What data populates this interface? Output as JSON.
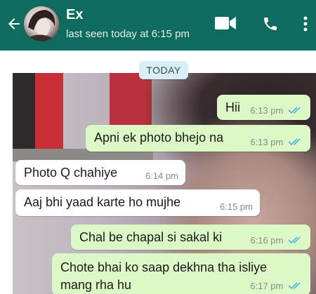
{
  "header": {
    "contact_name": "Ex",
    "status": "last seen today at 6:15 pm"
  },
  "date_chip": "TODAY",
  "messages": [
    {
      "direction": "out",
      "text": "Hii",
      "time": "6:13 pm",
      "read": true
    },
    {
      "direction": "out",
      "text": "Apni ek photo bhejo na",
      "time": "6:13 pm",
      "read": true
    },
    {
      "direction": "in",
      "text": "Photo Q chahiye",
      "time": "6:14 pm"
    },
    {
      "direction": "in",
      "text": "Aaj bhi yaad karte ho mujhe",
      "time": "6:15 pm"
    },
    {
      "direction": "out",
      "text": "Chal be chapal si sakal ki",
      "time": "6:16 pm",
      "read": true
    },
    {
      "direction": "out",
      "text": "Chote bhai ko saap dekhna tha isliye mang rha hu",
      "time": "6:17 pm",
      "read": true
    }
  ],
  "colors": {
    "header": "#0e6b5e",
    "outgoing_bubble": "#dcf8c6",
    "incoming_bubble": "#ffffff",
    "read_tick": "#4fb3e6",
    "date_chip": "#d8eef5"
  },
  "icons": [
    "back-arrow-icon",
    "video-call-icon",
    "phone-icon",
    "more-options-icon",
    "double-check-icon"
  ]
}
